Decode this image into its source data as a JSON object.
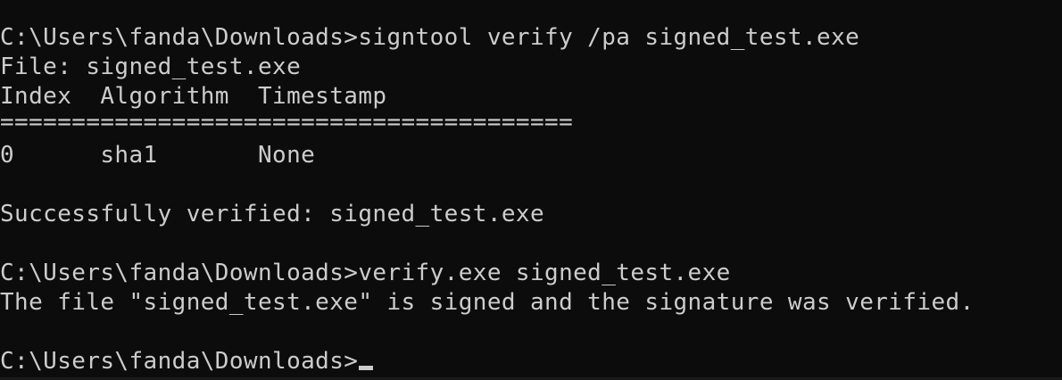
{
  "console": {
    "lines": [
      "C:\\Users\\fanda\\Downloads>signtool verify /pa signed_test.exe",
      "File: signed_test.exe",
      "Index  Algorithm  Timestamp",
      "========================================",
      "0      sha1       None",
      "",
      "Successfully verified: signed_test.exe",
      "",
      "C:\\Users\\fanda\\Downloads>verify.exe signed_test.exe",
      "The file \"signed_test.exe\" is signed and the signature was verified.",
      "",
      "C:\\Users\\fanda\\Downloads>"
    ]
  },
  "colors": {
    "background": "#0c0c0c",
    "foreground": "#cccccc"
  }
}
